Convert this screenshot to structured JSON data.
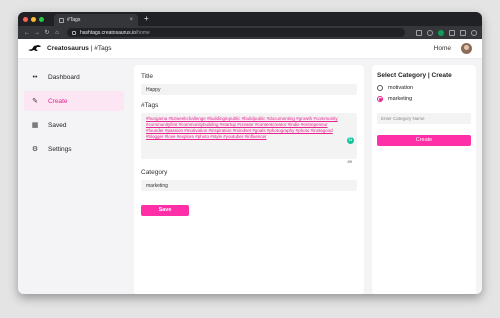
{
  "browser": {
    "tab_title": "#Tags",
    "url_domain": "hashtags.creatosaurus.io",
    "url_path": "/home",
    "colors": {
      "close": "#ff5f57",
      "minimize": "#febc2e",
      "maximize": "#28c840"
    }
  },
  "header": {
    "brand_name": "Creatosaurus",
    "brand_suffix": " | #Tags",
    "home_label": "Home"
  },
  "sidebar": {
    "items": [
      {
        "label": "Dashboard",
        "icon": "dashboard-icon"
      },
      {
        "label": "Create",
        "icon": "create-icon"
      },
      {
        "label": "Saved",
        "icon": "saved-icon"
      },
      {
        "label": "Settings",
        "icon": "settings-icon"
      }
    ],
    "active": "Create"
  },
  "editor": {
    "title_label": "Title",
    "title_value": "Happy",
    "tags_label": "#Tags",
    "tags_text": "#hungama #52weekchallenge #buildinginpublic #buildpublic #documenting #growth #community #communityfirst #communitybuilding #startup #creator #contentcreator #indie #entrepeneur #founder #passion #motivation #inspiration #mindset #goals #photography #photo #instagood #blogger #love #explore #photo #style #youtuber #influencer",
    "char_count": "89",
    "category_label": "Category",
    "category_value": "marketing",
    "save_label": "Save"
  },
  "category_panel": {
    "title": "Select Category | Create",
    "options": [
      {
        "label": "motivation",
        "checked": false
      },
      {
        "label": "marketing",
        "checked": true
      }
    ],
    "input_placeholder": "Enter Category Name",
    "create_label": "Create"
  },
  "colors": {
    "accent": "#ff2fa8",
    "accent_text": "#e8238f",
    "active_bg": "#fde6f3"
  }
}
